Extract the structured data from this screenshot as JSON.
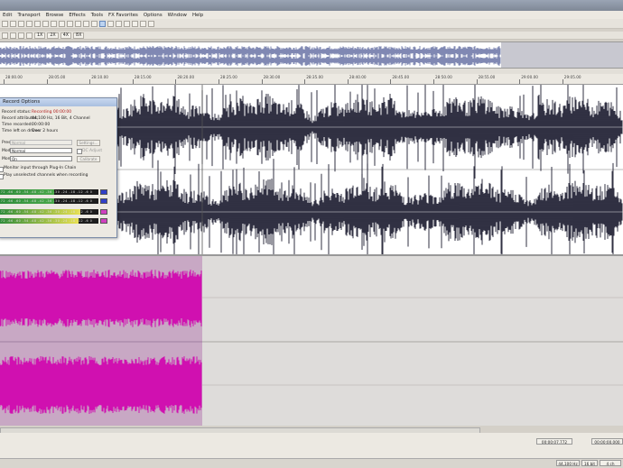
{
  "menu": [
    "Edit",
    "Transport",
    "Browse",
    "Effects",
    "Tools",
    "FX Favorites",
    "Options",
    "Window",
    "Help"
  ],
  "toolbar": {
    "row2_labels": [
      "1X",
      "2X",
      "4X",
      "8X"
    ]
  },
  "ruler": {
    "ticks": [
      "28:00.00",
      "28:05.00",
      "28:10.00",
      "28:15.00",
      "28:20.00",
      "28:25.00",
      "28:30.00",
      "28:35.00",
      "28:40.00",
      "28:45.00",
      "28:50.00",
      "28:55.00",
      "29:00.00",
      "29:05.00"
    ]
  },
  "dialog": {
    "title": "Record Options",
    "record_status_label": "Record status:",
    "record_status_value": "Recording 00:00:00",
    "record_attr_label": "Record attributes:",
    "record_attr_value": "44,100 Hz, 16 Bit, 4 Channel",
    "time_recorded_label": "Time recorded:",
    "time_recorded_value": "00:00:00",
    "time_left_label": "Time left on drives:",
    "time_left_value": "Over 2 hours",
    "preset_label": "Preset:",
    "preset_value": "Normal",
    "mode_label": "Mode:",
    "mode_value": "Normal",
    "monitor_label": "Monitor:",
    "monitor_value": "On",
    "settings_btn": "Settings...",
    "dc_adjust": "DC Adjust",
    "calibrate_btn": "Calibrate",
    "monitor_plugin": "Monitor input through Plug-In Chain",
    "play_unselected": "Play unselected channels when recording",
    "meter_channels": [
      {
        "label": "1/2",
        "level": 0.55,
        "color": "#4aa84a"
      },
      {
        "label": "1/2",
        "level": 0.55,
        "color": "#4aa84a"
      },
      {
        "label": "3/4",
        "level": 0.82,
        "color": "#e8e050"
      },
      {
        "label": "3/4",
        "level": 0.8,
        "color": "#e8e050"
      }
    ],
    "meter_scale": "-72 -66 -60 -54 -48 -42 -36 -30 -24 -18 -12 -6 0",
    "meter_btn_colors": [
      "#3040c8",
      "#3040c8",
      "#d040c0",
      "#d040c0"
    ]
  },
  "status": {
    "cursor_pos": "00:00:07.772",
    "selection_length": "00:00:00.000",
    "sample_rate": "44,100 Hz",
    "bit_depth": "16 bit",
    "channels": "4 ch"
  },
  "colors": {
    "recorded_wave": "#1a1a2e",
    "recording_wave": "#d010b0",
    "recording_bg": "#c8a8c4"
  }
}
